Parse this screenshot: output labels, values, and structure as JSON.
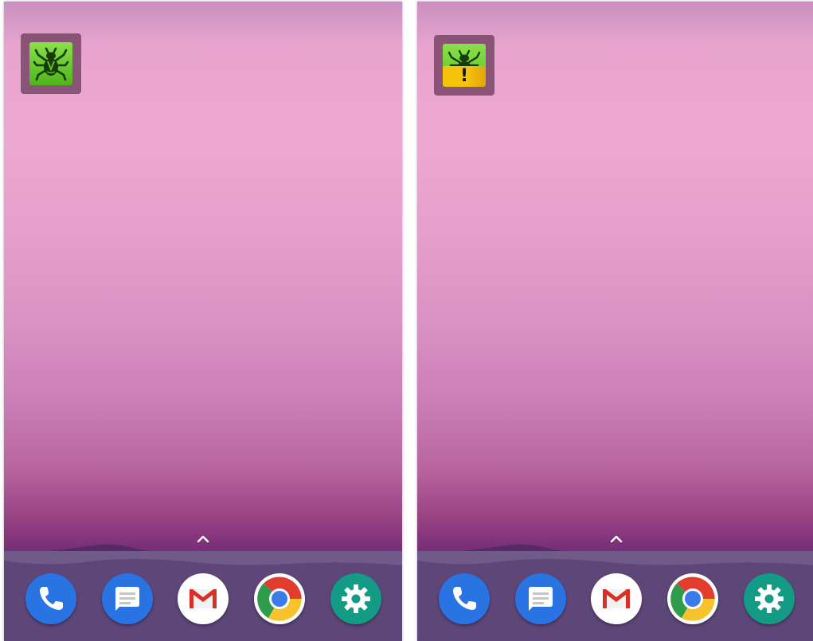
{
  "screens": [
    {
      "app_icon": {
        "icon": "dr-web-spider-icon",
        "status": "ok",
        "color": "#5cc224"
      },
      "dock": [
        "phone-icon",
        "messages-icon",
        "gmail-icon",
        "chrome-icon",
        "settings-icon"
      ]
    },
    {
      "app_icon": {
        "icon": "dr-web-spider-warning-icon",
        "status": "warning",
        "warning_mark": "!",
        "color": "#f5c40a"
      },
      "dock": [
        "phone-icon",
        "messages-icon",
        "gmail-icon",
        "chrome-icon",
        "settings-icon"
      ]
    }
  ],
  "colors": {
    "dock_background": "#5d4678",
    "phone_app": "#2a73e3",
    "messages_app": "#2a73e3",
    "settings_app": "#139b86"
  }
}
